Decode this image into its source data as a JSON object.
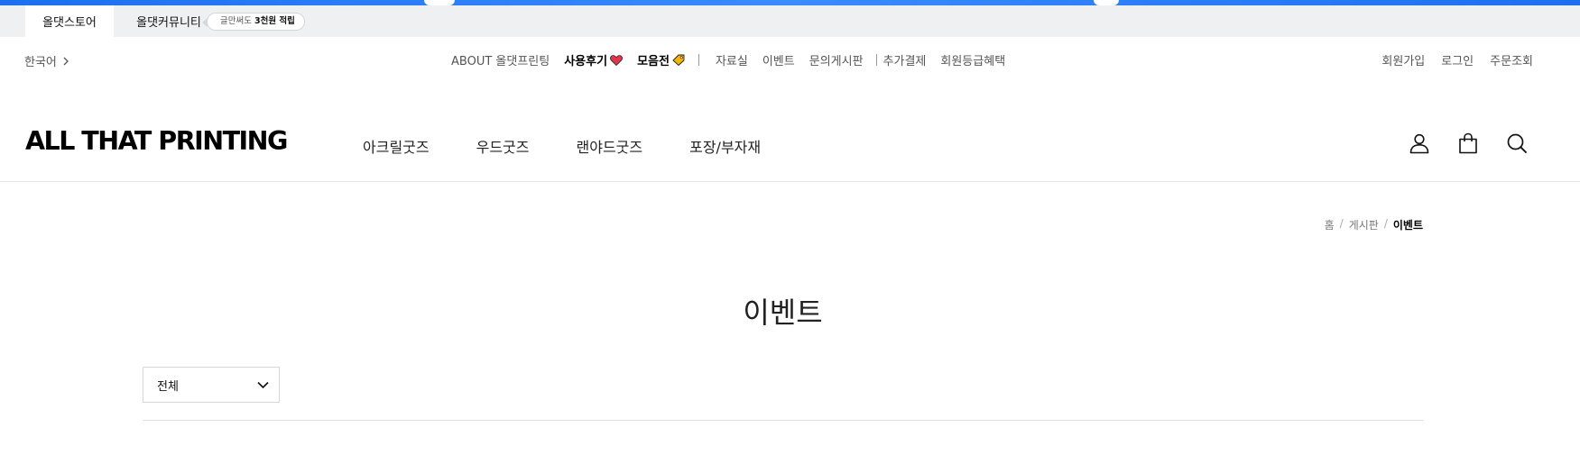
{
  "store_bar": {
    "tabs": [
      "올댓스토어",
      "올댓커뮤니티"
    ],
    "promo_prefix": "글만써도",
    "promo_bold": "3천원 적립"
  },
  "util": {
    "language": "한국어",
    "nav": [
      "ABOUT 올댓프린팅",
      "사용후기",
      "모음전",
      "자료실",
      "이벤트",
      "문의게시판",
      "추가결제",
      "회원등급혜택"
    ],
    "auth": [
      "회원가입",
      "로그인",
      "주문조회"
    ]
  },
  "header": {
    "logo": "ALL THAT PRINTING",
    "gnb": [
      "아크릴굿즈",
      "우드굿즈",
      "랜야드굿즈",
      "포장/부자재"
    ],
    "icons": [
      "user-icon",
      "bag-icon",
      "search-icon"
    ]
  },
  "breadcrumb": [
    "홈",
    "게시판",
    "이벤트"
  ],
  "page": {
    "title": "이벤트",
    "filter_value": "전체"
  },
  "colors": {
    "accent_blue": "#1c6ff0",
    "heart": "#e5344e",
    "tag": "#f5b400"
  }
}
